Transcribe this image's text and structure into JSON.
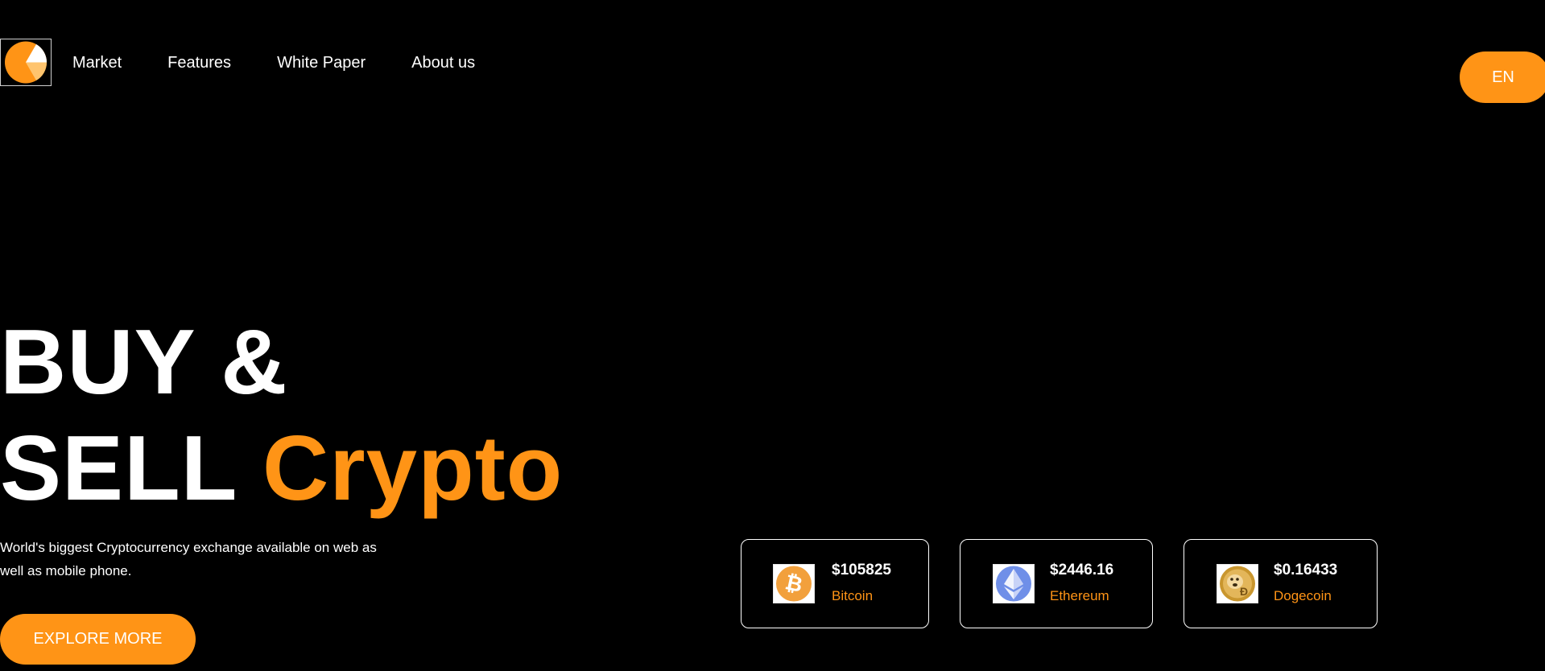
{
  "brand": {
    "logo_icon": "half-circle-logo-icon",
    "accent_color": "#ff9416"
  },
  "nav": {
    "items": [
      {
        "label": "Market"
      },
      {
        "label": "Features"
      },
      {
        "label": "White Paper"
      },
      {
        "label": "About us"
      }
    ]
  },
  "language_button": {
    "label": "EN"
  },
  "hero": {
    "line1": "BUY &",
    "line2_prefix": "SELL",
    "line2_accent": "Crypto",
    "subtitle": "World's biggest Cryptocurrency exchange available on web as well as mobile phone.",
    "cta_label": "EXPLORE MORE"
  },
  "coins": [
    {
      "price": "$105825",
      "name": "Bitcoin",
      "icon": "bitcoin-icon",
      "icon_color": "#f2a03c"
    },
    {
      "price": "$2446.16",
      "name": "Ethereum",
      "icon": "ethereum-icon",
      "icon_color": "#6f8fe8"
    },
    {
      "price": "$0.16433",
      "name": "Dogecoin",
      "icon": "dogecoin-icon",
      "icon_color": "#c9962e"
    }
  ]
}
